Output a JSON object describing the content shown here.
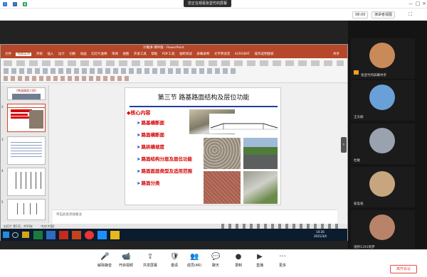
{
  "meeting": {
    "banner": "您正在观看张显竹的屏幕",
    "time": "08:00",
    "view_button": "演讲者视图",
    "leave_button": "离开会议"
  },
  "ppt": {
    "window_title": "计概讲-课件版 - PowerPoint",
    "menu": [
      "文件",
      "经典菜单",
      "开始",
      "插入",
      "设计",
      "切换",
      "动画",
      "幻灯片放映",
      "审阅",
      "视图",
      "开发工具",
      "帮助",
      "PDF工具",
      "福昕阅读",
      "屏幕录制",
      "文字转语音",
      "ACROBAT"
    ],
    "menu_search": "操作说明搜索",
    "share": "共享",
    "thumb1_caption": "《铁道路面工程》",
    "notes_placeholder": "单击此处添加备注",
    "status_left": "幻灯片 第1页，共50张",
    "status_lang": "中文(中国)",
    "slide": {
      "title": "第三节  路基路面结构及层位功能",
      "heading": "核心内容",
      "bullets": [
        "路基横断面",
        "路面横断面",
        "路拱横坡度",
        "路面结构分层及层位功能",
        "路面面层类型及适用范围",
        "路面分类"
      ]
    },
    "taskbar_time": "10:26",
    "taskbar_date": "2021/3/4",
    "thumb_numbers": [
      "2",
      "3",
      "4",
      "5"
    ]
  },
  "participants": [
    {
      "name": "张显竹的屏幕共享",
      "color": "#c98a5a"
    },
    {
      "name": "王天楠",
      "color": "#6aa0d8"
    },
    {
      "name": "杜敏",
      "color": "#9aa2b0"
    },
    {
      "name": "安盈逸",
      "color": "#c7a67f"
    },
    {
      "name": "道桥1191周梦",
      "color": "#b9836a"
    }
  ],
  "toolbar": [
    {
      "icon": "mic-icon",
      "glyph": "🎤",
      "label": "解除静音"
    },
    {
      "icon": "video-icon",
      "glyph": "📹",
      "label": "开启视频"
    },
    {
      "icon": "share-screen-icon",
      "glyph": "⇪",
      "label": "共享屏幕"
    },
    {
      "icon": "security-icon",
      "glyph": "🛡",
      "label": "邀请"
    },
    {
      "icon": "members-icon",
      "glyph": "👥",
      "label": "成员(46)"
    },
    {
      "icon": "chat-icon",
      "glyph": "💬",
      "label": "聊天"
    },
    {
      "icon": "record-icon",
      "glyph": "●",
      "label": "录制"
    },
    {
      "icon": "live-icon",
      "glyph": "▶",
      "label": "直播"
    },
    {
      "icon": "more-icon",
      "glyph": "···",
      "label": "更多"
    }
  ]
}
